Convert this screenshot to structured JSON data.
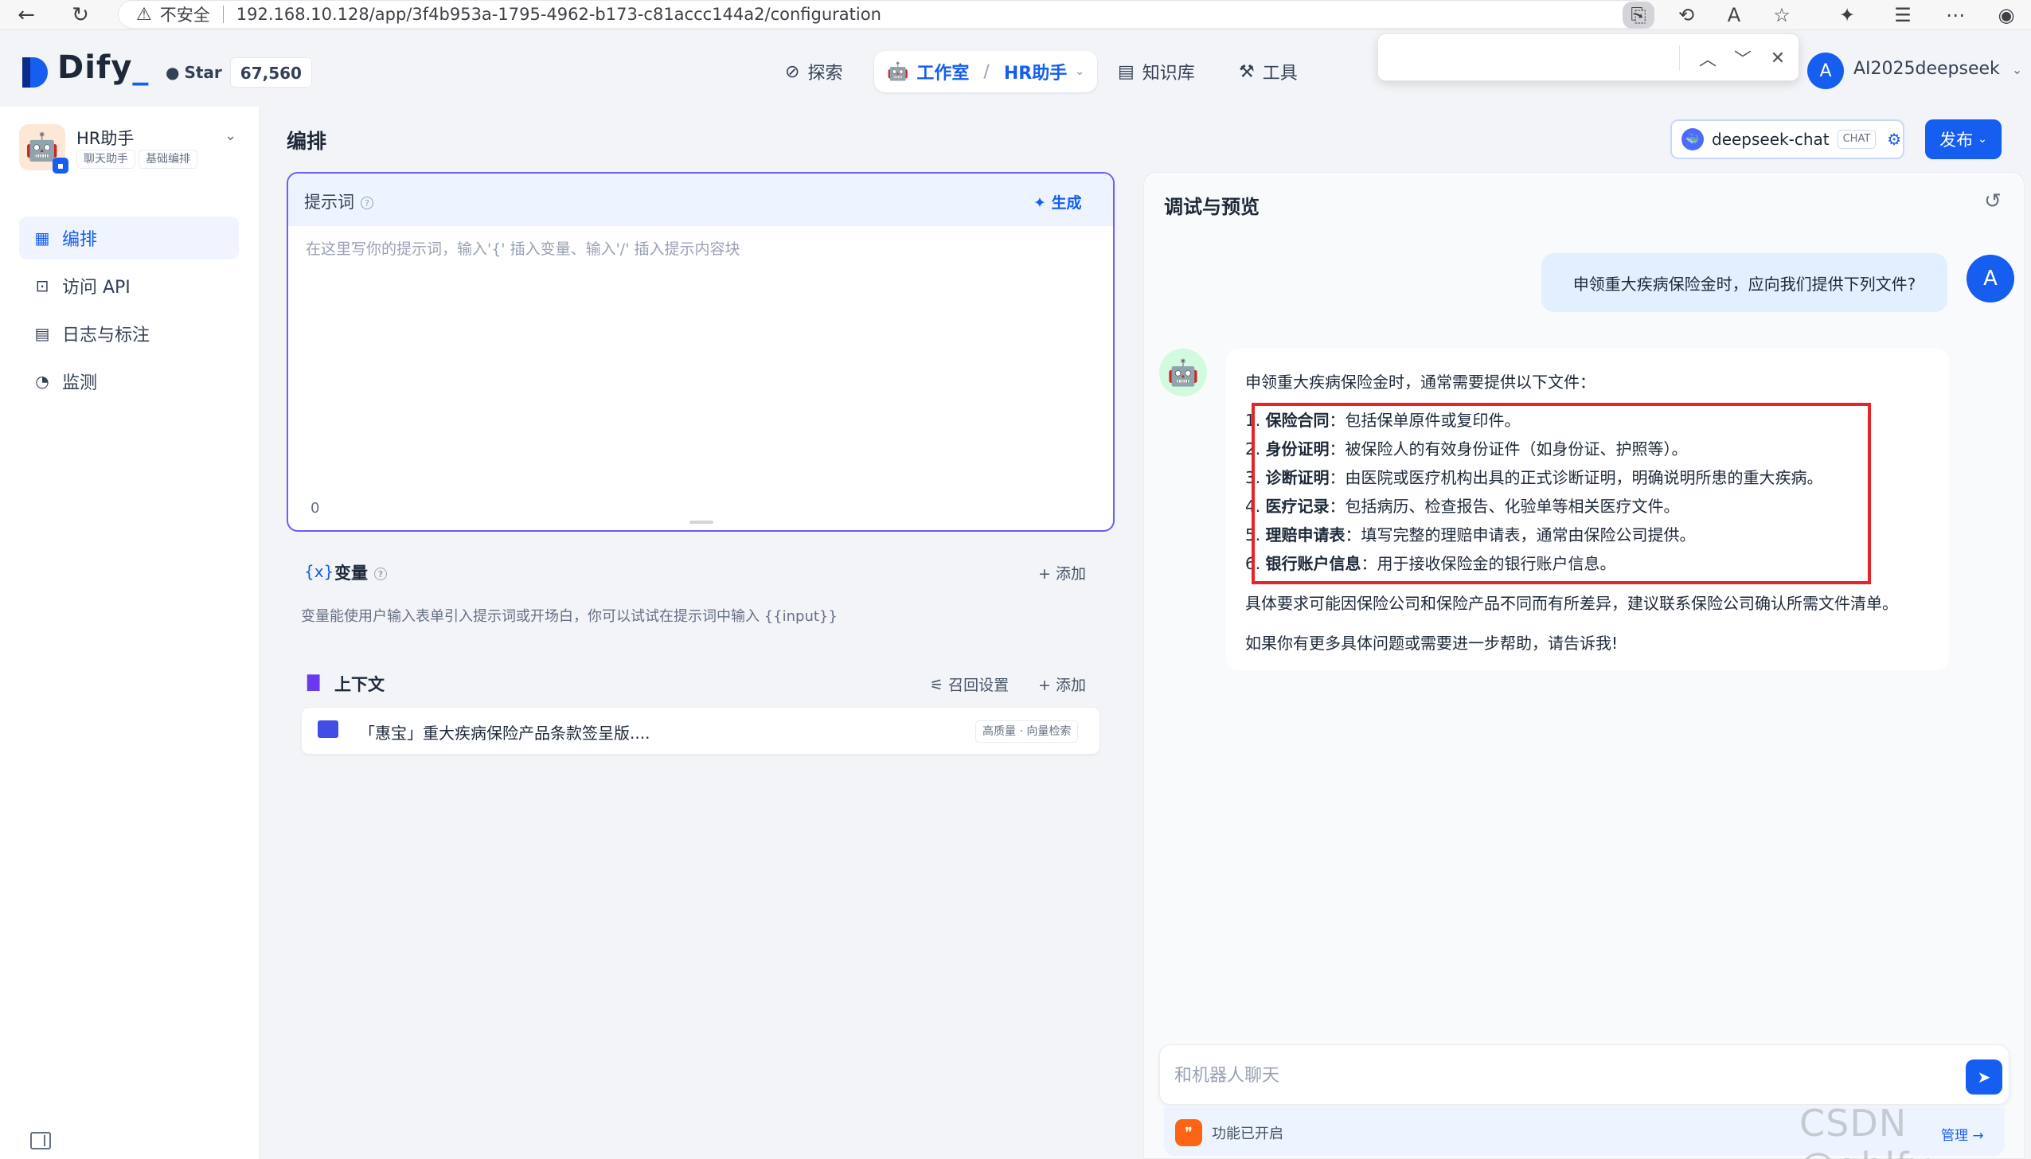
{
  "browser": {
    "security_label": "不安全",
    "url": "192.168.10.128/app/3f4b953a-1795-4962-b173-c81accc144a2/configuration"
  },
  "header": {
    "logo": "Dify",
    "github_star_label": "Star",
    "github_star_count": "67,560",
    "nav": {
      "explore": "探索",
      "studio": "工作室",
      "current_app": "HR助手",
      "knowledge": "知识库",
      "tools": "工具"
    },
    "user_initial": "A",
    "user_name": "AI2025deepseek"
  },
  "sidebar": {
    "app_name": "HR助手",
    "app_tags": [
      "聊天助手",
      "基础编排"
    ],
    "items": [
      {
        "label": "编排",
        "icon": "layout-icon",
        "active": true
      },
      {
        "label": "访问 API",
        "icon": "terminal-icon",
        "active": false
      },
      {
        "label": "日志与标注",
        "icon": "file-text-icon",
        "active": false
      },
      {
        "label": "监测",
        "icon": "gauge-icon",
        "active": false
      }
    ]
  },
  "orchestrate": {
    "title": "编排",
    "prompt": {
      "label": "提示词",
      "generate_label": "生成",
      "placeholder": "在这里写你的提示词，输入'{' 插入变量、输入'/' 插入提示内容块",
      "char_count": "0"
    },
    "variables": {
      "label": "变量",
      "icon_text": "{x}",
      "add_label": "添加",
      "description": "变量能使用户输入表单引入提示词或开场白，你可以试试在提示词中输入 {{input}}"
    },
    "context": {
      "label": "上下文",
      "recall_label": "召回设置",
      "add_label": "添加",
      "dataset_name": "「惠宝」重大疾病保险产品条款签呈版....",
      "dataset_tag": "高质量 · 向量检索"
    }
  },
  "model": {
    "name": "deepseek-chat",
    "mode_tag": "CHAT",
    "publish_label": "发布"
  },
  "debug": {
    "title": "调试与预览",
    "user_message": "申领重大疾病保险金时，应向我们提供下列文件?",
    "user_initial": "A",
    "bot_reply": {
      "intro": "申领重大疾病保险金时，通常需要提供以下文件：",
      "items": [
        {
          "num": "1. ",
          "bold": "保险合同",
          "text": "：包括保单原件或复印件。"
        },
        {
          "num": "2. ",
          "bold": "身份证明",
          "text": "：被保险人的有效身份证件（如身份证、护照等）。"
        },
        {
          "num": "3. ",
          "bold": "诊断证明",
          "text": "：由医院或医疗机构出具的正式诊断证明，明确说明所患的重大疾病。"
        },
        {
          "num": "4. ",
          "bold": "医疗记录",
          "text": "：包括病历、检查报告、化验单等相关医疗文件。"
        },
        {
          "num": "5. ",
          "bold": "理赔申请表",
          "text": "：填写完整的理赔申请表，通常由保险公司提供。"
        },
        {
          "num": "6. ",
          "bold": "银行账户信息",
          "text": "：用于接收保险金的银行账户信息。"
        }
      ],
      "note": "具体要求可能因保险公司和保险产品不同而有所差异，建议联系保险公司确认所需文件清单。",
      "closing": "如果你有更多具体问题或需要进一步帮助，请告诉我!"
    },
    "chat_placeholder": "和机器人聊天",
    "feature_label": "功能已开启",
    "manage_label": "管理"
  },
  "watermark": "CSDN @gblfy"
}
